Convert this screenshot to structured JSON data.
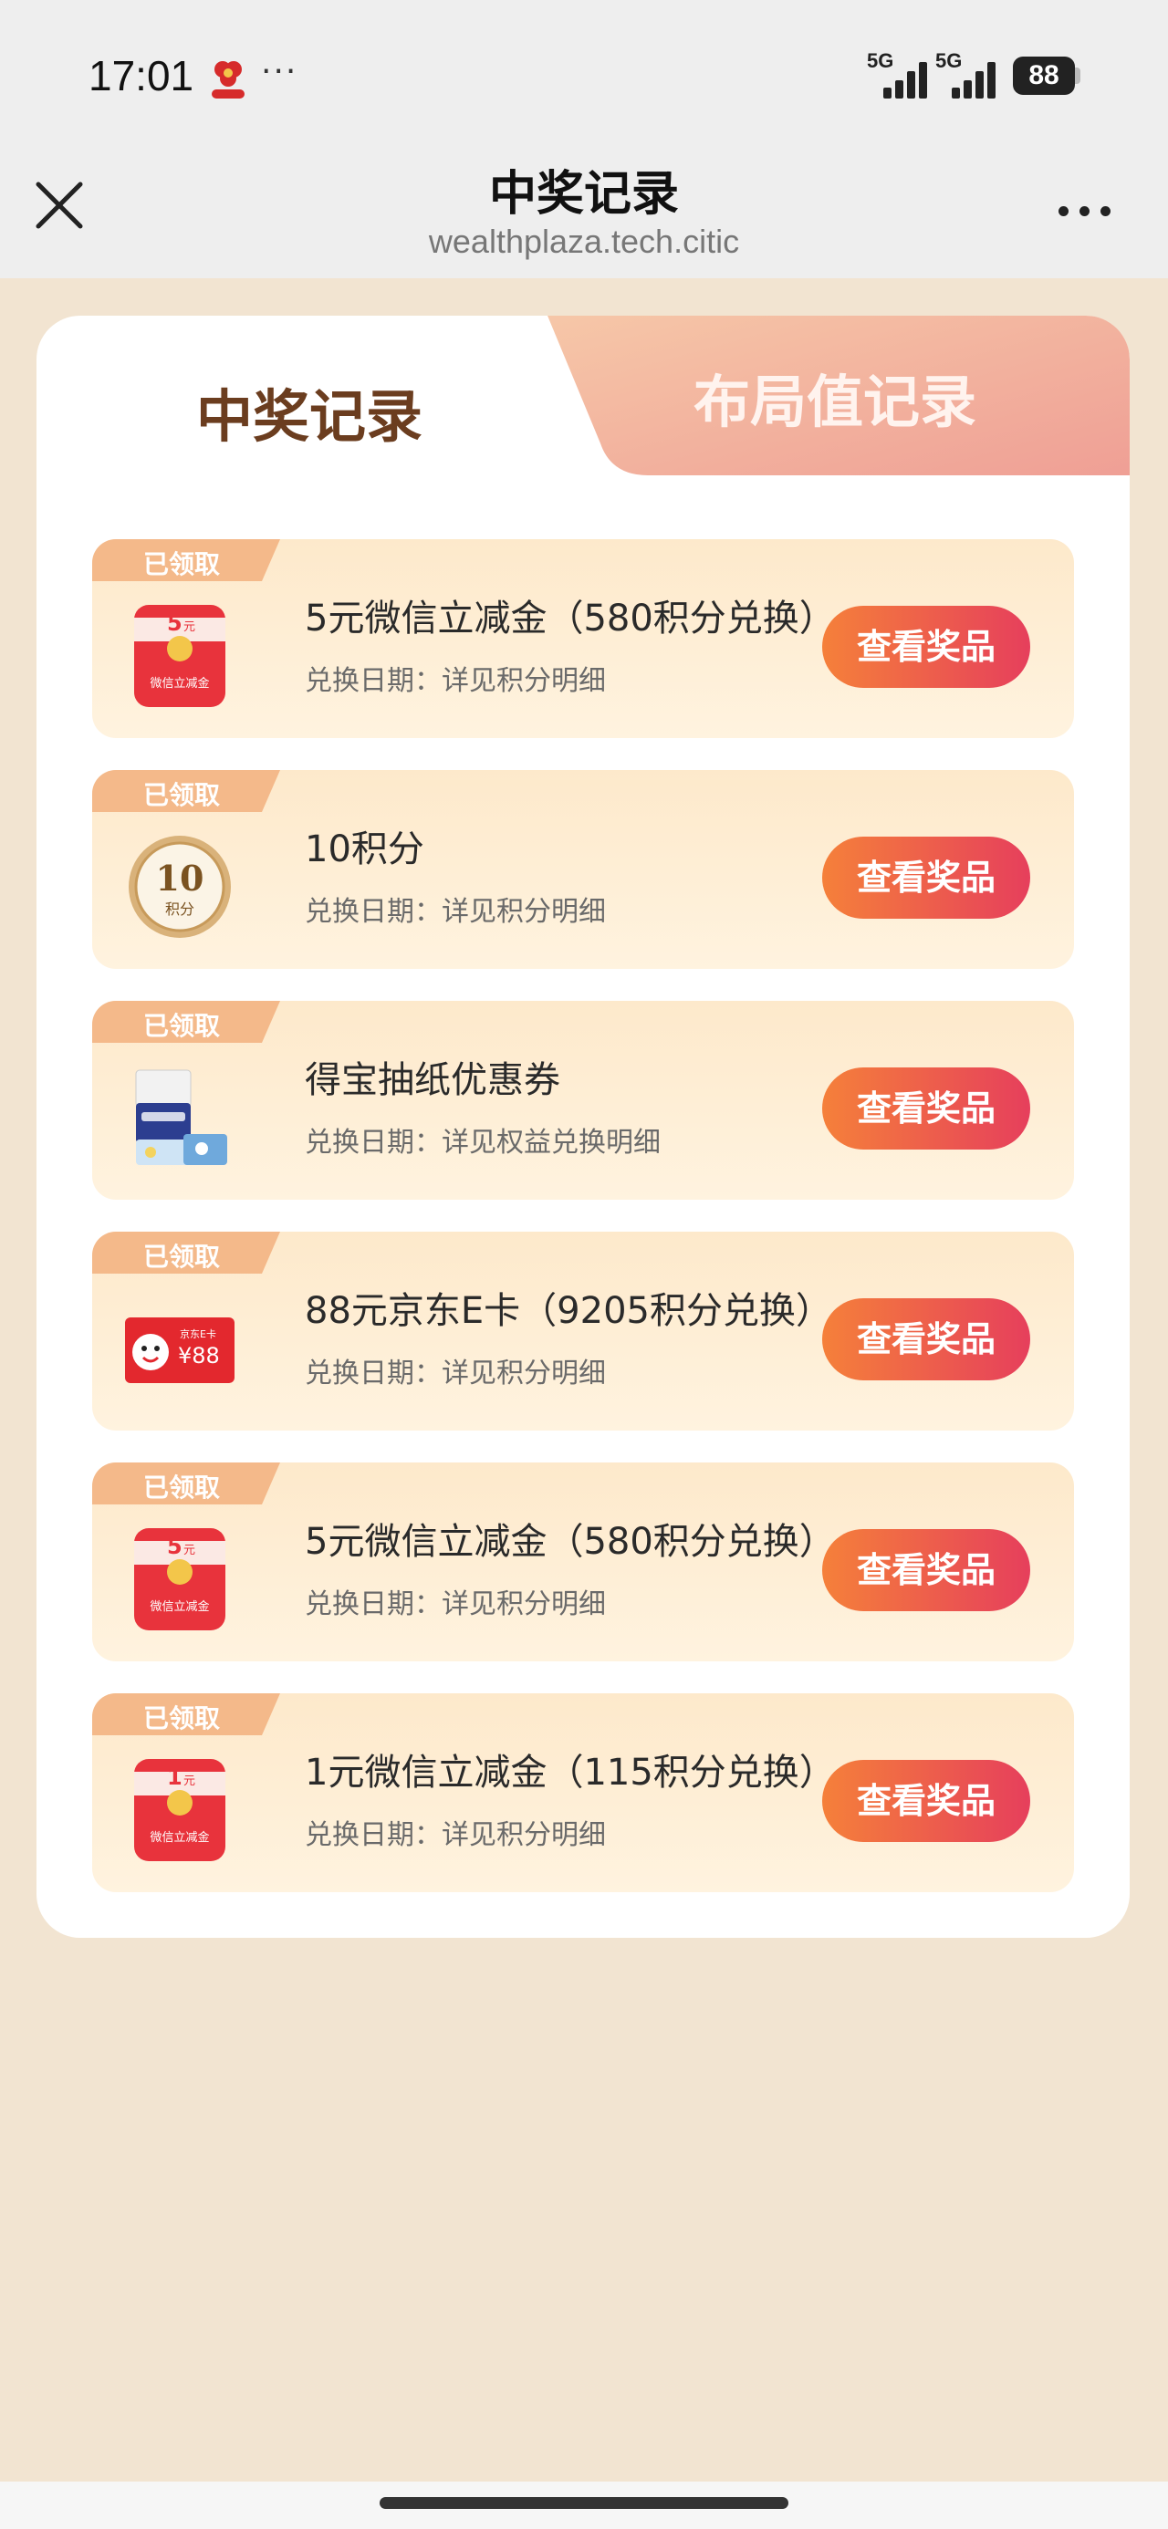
{
  "status_bar": {
    "time": "17:01",
    "more": "···",
    "signal_1": "5G",
    "signal_2": "5G",
    "battery": "88",
    "app_icon": "red-app-icon"
  },
  "nav": {
    "title": "中奖记录",
    "subtitle": "wealthplaza.tech.citic",
    "close_icon": "close-icon",
    "more_icon": "more-dots-icon"
  },
  "tabs": [
    {
      "label": "中奖记录",
      "active": true
    },
    {
      "label": "布局值记录",
      "active": false
    }
  ],
  "records": [
    {
      "badge": "已领取",
      "title": "5元微信立减金（580积分兑换）",
      "date": "兑换日期：详见积分明细",
      "button": "查看奖品",
      "thumb": "red-packet-icon",
      "amount": "5",
      "unit": "元",
      "thumb_caption": "微信立减金"
    },
    {
      "badge": "已领取",
      "title": "10积分",
      "date": "兑换日期：详见积分明细",
      "button": "查看奖品",
      "thumb": "points-coin-icon",
      "amount": "10",
      "unit": "积分"
    },
    {
      "badge": "已领取",
      "title": "得宝抽纸优惠券",
      "date": "兑换日期：详见权益兑换明细",
      "button": "查看奖品",
      "thumb": "tissue-pack-icon"
    },
    {
      "badge": "已领取",
      "title": "88元京东E卡（9205积分兑换）",
      "date": "兑换日期：详见积分明细",
      "button": "查看奖品",
      "thumb": "jd-card-icon",
      "card_brand": "京东E卡",
      "card_value": "¥88"
    },
    {
      "badge": "已领取",
      "title": "5元微信立减金（580积分兑换）",
      "date": "兑换日期：详见积分明细",
      "button": "查看奖品",
      "thumb": "red-packet-icon",
      "amount": "5",
      "unit": "元",
      "thumb_caption": "微信立减金"
    },
    {
      "badge": "已领取",
      "title": "1元微信立减金（115积分兑换）",
      "date": "兑换日期：详见积分明细",
      "button": "查看奖品",
      "thumb": "red-packet-icon",
      "amount": "1",
      "unit": "元",
      "thumb_caption": "微信立减金"
    }
  ],
  "colors": {
    "page_bg": "#f2e4d1",
    "button_start": "#f5803a",
    "button_end": "#e63f5c",
    "active_tab_text": "#6b3d1f"
  }
}
